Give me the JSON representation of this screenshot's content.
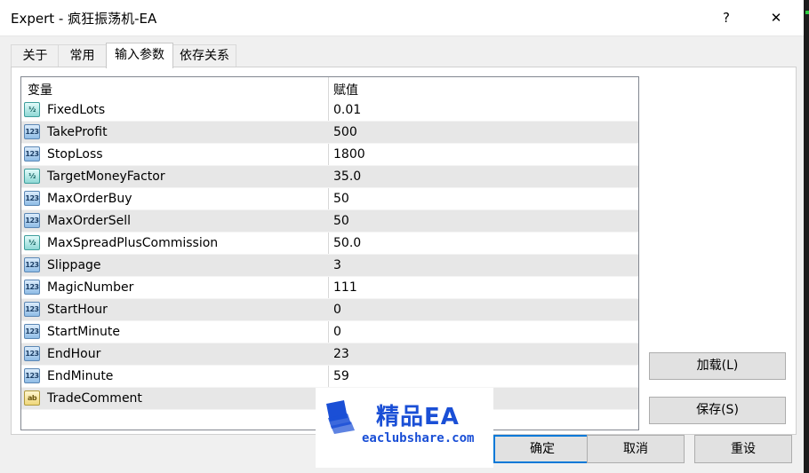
{
  "window": {
    "title": "Expert - 疯狂振荡机-EA",
    "help_glyph": "?",
    "close_glyph": "✕"
  },
  "tabs": [
    {
      "label": "关于"
    },
    {
      "label": "常用"
    },
    {
      "label": "输入参数",
      "active": true
    },
    {
      "label": "依存关系"
    }
  ],
  "grid": {
    "col_variable": "变量",
    "col_value": "赋值",
    "rows": [
      {
        "icon": "fraction-icon",
        "name": "FixedLots",
        "value": "0.01"
      },
      {
        "icon": "integer-icon",
        "name": "TakeProfit",
        "value": "500"
      },
      {
        "icon": "integer-icon",
        "name": "StopLoss",
        "value": "1800"
      },
      {
        "icon": "fraction-icon",
        "name": "TargetMoneyFactor",
        "value": "35.0"
      },
      {
        "icon": "integer-icon",
        "name": "MaxOrderBuy",
        "value": "50"
      },
      {
        "icon": "integer-icon",
        "name": "MaxOrderSell",
        "value": "50"
      },
      {
        "icon": "fraction-icon",
        "name": "MaxSpreadPlusCommission",
        "value": "50.0"
      },
      {
        "icon": "integer-icon",
        "name": "Slippage",
        "value": "3"
      },
      {
        "icon": "integer-icon",
        "name": "MagicNumber",
        "value": "111"
      },
      {
        "icon": "integer-icon",
        "name": "StartHour",
        "value": "0"
      },
      {
        "icon": "integer-icon",
        "name": "StartMinute",
        "value": "0"
      },
      {
        "icon": "integer-icon",
        "name": "EndHour",
        "value": "23"
      },
      {
        "icon": "integer-icon",
        "name": "EndMinute",
        "value": "59"
      },
      {
        "icon": "string-icon",
        "name": "TradeComment",
        "value": ""
      }
    ],
    "icon_glyphs": {
      "fraction": "½",
      "integer": "123",
      "string": "ab"
    }
  },
  "buttons": {
    "load": "加载(L)",
    "save": "保存(S)",
    "ok": "确定",
    "cancel": "取消",
    "reset": "重设"
  },
  "watermark": {
    "title": "精品EA",
    "url": "eaclubshare.com"
  },
  "colors": {
    "accent": "#0078d7",
    "watermark_blue": "#1a4fd6"
  }
}
